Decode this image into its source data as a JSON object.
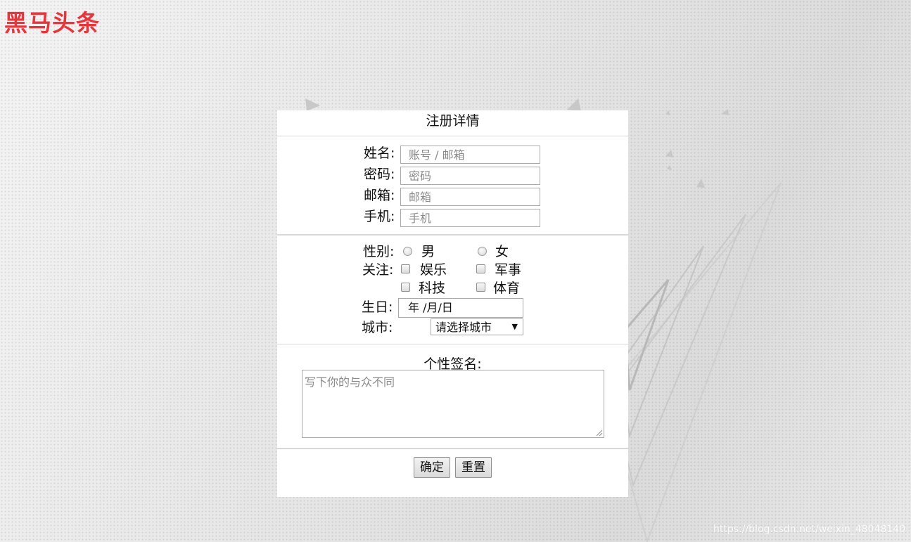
{
  "logo": "黑马头条",
  "watermark": "https://blog.csdn.net/weixin_48048140",
  "form": {
    "title": "注册详情",
    "name_label": "姓名:",
    "name_placeholder": "账号 / 邮箱",
    "password_label": "密码:",
    "password_placeholder": "密码",
    "email_label": "邮箱:",
    "email_placeholder": "邮箱",
    "phone_label": "手机:",
    "phone_placeholder": "手机",
    "gender_label": "性别:",
    "gender_options": [
      "男",
      "女"
    ],
    "interest_label": "关注:",
    "interest_options": [
      "娱乐",
      "军事",
      "科技",
      "体育"
    ],
    "birthday_label": "生日:",
    "birthday_value": "年 /月/日",
    "city_label": "城市:",
    "city_value": "请选择城市",
    "signature_label": "个性签名:",
    "signature_placeholder": "写下你的与众不同",
    "confirm_label": "确定",
    "reset_label": "重置"
  }
}
